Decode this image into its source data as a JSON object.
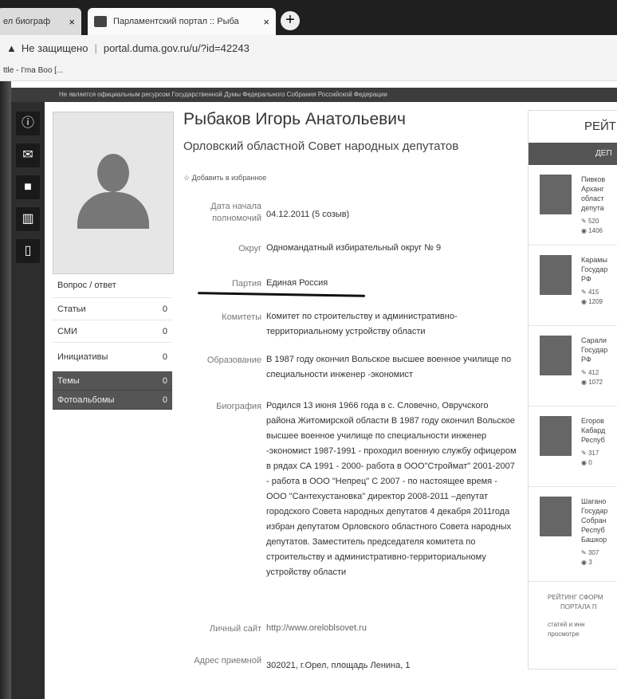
{
  "browser": {
    "tab1": "ел биограф",
    "tab2": "Парламентский портал :: Рыба",
    "close": "×",
    "new_tab": "+",
    "security": "Не защищено",
    "url": "portal.duma.gov.ru/u/?id=42243",
    "bookmark": "ttle - I'ma Boo [..."
  },
  "strip_text": "Не является официальным ресурсом Государственной Думы Федерального Собрания Российской Федерации",
  "deputy": {
    "name": "Рыбаков Игорь Анатольевич",
    "council": "Орловский областной Совет народных депутатов",
    "favorite": "☆ Добавить в избранное",
    "fields": [
      {
        "label": "Дата начала полномочий",
        "value": "04.12.2011 (5 созыв)"
      },
      {
        "label": "Округ",
        "value": "Одномандатный избирательный округ № 9"
      },
      {
        "label": "Партия",
        "value": "Единая Россия"
      },
      {
        "label": "Комитеты",
        "value": "Комитет по строительству и административно-территориальному устройству области"
      },
      {
        "label": "Образование",
        "value": "В 1987 году окончил Вольское высшее военное училище по специальности инженер -экономист"
      },
      {
        "label": "Биография",
        "value": "Родился 13 июня 1966 года в с. Словечно, Овручского района Житомирской области В 1987 году окончил Вольское высшее военное училище по специальности инженер -экономист 1987-1991 - проходил военную службу офицером в рядах СА 1991 - 2000- работа в ООО\"Строймат\" 2001-2007 - работа в ООО \"Непрец\" С 2007 - по настоящее время - ООО \"Сантехустановка\" директор 2008-2011 –депутат городского Совета народных депутатов 4 декабря 2011года избран депутатом Орловского областного Совета народных депутатов. Заместитель председателя комитета по строительству и административно-территориальному устройству области"
      },
      {
        "label": "Личный сайт",
        "value": "http://www.oreloblsovet.ru"
      },
      {
        "label": "Адрес приемной",
        "value": "302021, г.Орел, площадь Ленина, 1"
      }
    ]
  },
  "left_menu": {
    "qa": "Вопрос / ответ",
    "items": [
      {
        "label": "Статьи",
        "count": "0"
      },
      {
        "label": "СМИ",
        "count": "0"
      },
      {
        "label": "Инициативы",
        "count": "0"
      },
      {
        "label": "Темы",
        "count": "0"
      },
      {
        "label": "Фотоальбомы",
        "count": "0"
      }
    ]
  },
  "rating": {
    "title": "РЕЙТ",
    "sub": "ДЕП",
    "cards": [
      {
        "text": "Пивков\nАрханг\nобласт\nдепута",
        "posts": "520",
        "views": "1406"
      },
      {
        "text": "Карамы\nГосудар\nРФ",
        "posts": "415",
        "views": "1209"
      },
      {
        "text": "Сарали\nГосудар\nРФ",
        "posts": "412",
        "views": "1072"
      },
      {
        "text": "Егоров\nКабард\nРеспуб",
        "posts": "317",
        "views": "0"
      },
      {
        "text": "Шагано\nГосудар\nСобран\nРеспуб\nБашкор",
        "posts": "307",
        "views": "3"
      }
    ],
    "footer1": "РЕЙТИНГ СФОРМ",
    "footer2": "ПОРТАЛА П",
    "footer3": "статей и инн",
    "footer4": "просмотре"
  },
  "icons": [
    "info-icon",
    "mail-icon",
    "video-icon",
    "book-icon",
    "phone-icon"
  ]
}
